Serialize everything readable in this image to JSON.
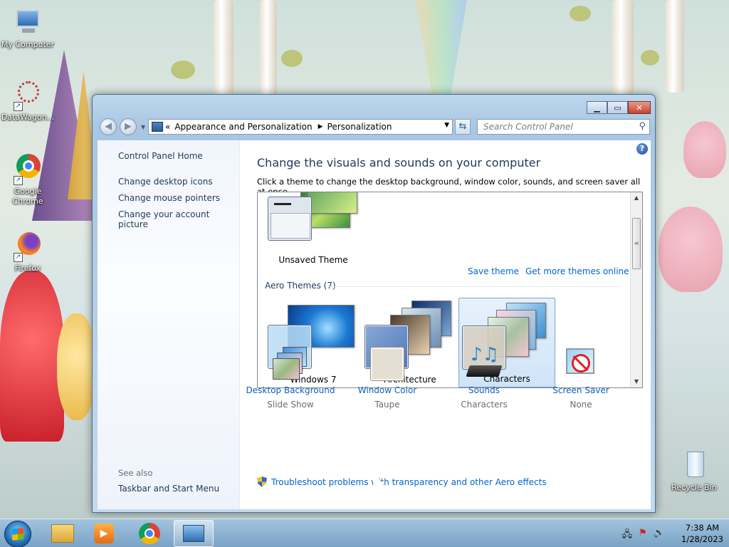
{
  "desktop": {
    "icons": [
      {
        "label": "My Computer"
      },
      {
        "label": "DataWagon..."
      },
      {
        "label": "Google Chrome"
      },
      {
        "label": "Firefox"
      },
      {
        "label": "Recycle Bin"
      }
    ]
  },
  "window": {
    "address": {
      "segments": [
        "Appearance and Personalization",
        "Personalization"
      ],
      "prefix": "«"
    },
    "search": {
      "placeholder": "Search Control Panel"
    },
    "left_pane": {
      "links": [
        "Control Panel Home",
        "Change desktop icons",
        "Change mouse pointers",
        "Change your account picture"
      ],
      "see_also_title": "See also",
      "see_also_links": [
        "Taskbar and Start Menu"
      ]
    },
    "main": {
      "heading": "Change the visuals and sounds on your computer",
      "description": "Click a theme to change the desktop background, window color, sounds, and screen saver all at once.",
      "unsaved_theme": "Unsaved Theme",
      "save_theme": "Save theme",
      "get_more": "Get more themes online",
      "group_label": "Aero Themes (7)",
      "themes": [
        {
          "name": "Windows 7",
          "selected": false
        },
        {
          "name": "Architecture",
          "selected": false
        },
        {
          "name": "Characters",
          "selected": true
        }
      ],
      "bottom_items": [
        {
          "title": "Desktop Background",
          "value": "Slide Show",
          "icon": "desktop-background-icon"
        },
        {
          "title": "Window Color",
          "value": "Taupe",
          "icon": "window-color-icon"
        },
        {
          "title": "Sounds",
          "value": "Characters",
          "icon": "sounds-icon"
        },
        {
          "title": "Screen Saver",
          "value": "None",
          "icon": "screen-saver-icon"
        }
      ],
      "troubleshoot": "Troubleshoot problems with transparency and other Aero effects"
    }
  },
  "taskbar": {
    "time": "7:38 AM",
    "date": "1/28/2023",
    "apps": [
      "file-explorer-icon",
      "media-player-icon",
      "chrome-icon",
      "control-panel-icon"
    ]
  },
  "colors": {
    "link": "#0066cc",
    "heading": "#1e395b",
    "window_color_taupe": "#e5ded2"
  }
}
